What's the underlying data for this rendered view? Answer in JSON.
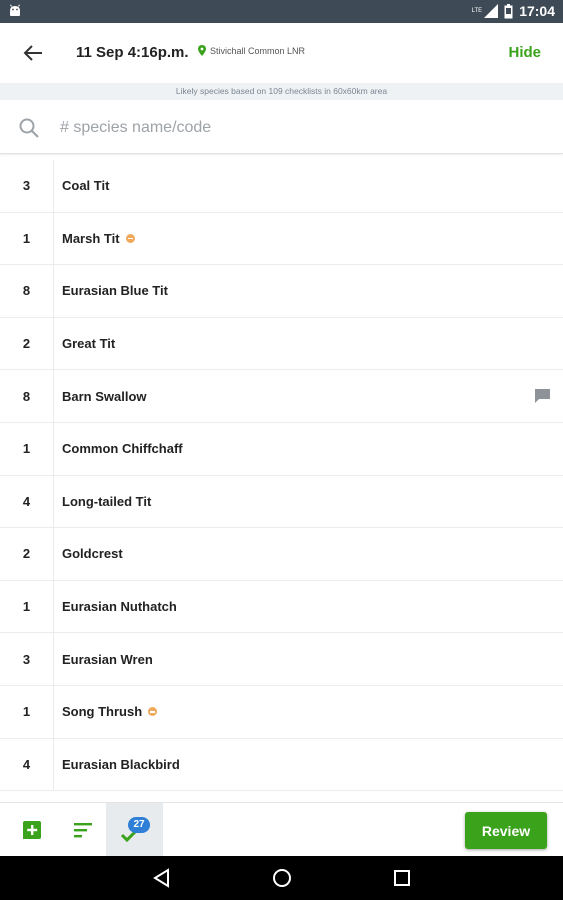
{
  "status_bar": {
    "time": "17:04",
    "network": "LTE"
  },
  "header": {
    "title": "11 Sep 4:16p.m.",
    "location": "Stivichall Common LNR",
    "hide_label": "Hide"
  },
  "banner": {
    "text": "Likely species based on 109 checklists in 60x60km area"
  },
  "search": {
    "placeholder": "# species name/code",
    "value": ""
  },
  "species": [
    {
      "count": "3",
      "name": "Coal Tit",
      "rare": false,
      "comment": false
    },
    {
      "count": "1",
      "name": "Marsh Tit",
      "rare": true,
      "comment": false
    },
    {
      "count": "8",
      "name": "Eurasian Blue Tit",
      "rare": false,
      "comment": false
    },
    {
      "count": "2",
      "name": "Great Tit",
      "rare": false,
      "comment": false
    },
    {
      "count": "8",
      "name": "Barn Swallow",
      "rare": false,
      "comment": true
    },
    {
      "count": "1",
      "name": "Common Chiffchaff",
      "rare": false,
      "comment": false
    },
    {
      "count": "4",
      "name": "Long-tailed Tit",
      "rare": false,
      "comment": false
    },
    {
      "count": "2",
      "name": "Goldcrest",
      "rare": false,
      "comment": false
    },
    {
      "count": "1",
      "name": "Eurasian Nuthatch",
      "rare": false,
      "comment": false
    },
    {
      "count": "3",
      "name": "Eurasian Wren",
      "rare": false,
      "comment": false
    },
    {
      "count": "1",
      "name": "Song Thrush",
      "rare": true,
      "comment": false
    },
    {
      "count": "4",
      "name": "Eurasian Blackbird",
      "rare": false,
      "comment": false
    }
  ],
  "toolbar": {
    "add_icon": "add-box-icon",
    "sort_icon": "sort-icon",
    "checked_icon": "check-icon",
    "checked_count": "27",
    "review_label": "Review"
  },
  "colors": {
    "accent": "#3aa31b",
    "status_bar": "#3e4a55",
    "badge": "#2f7fd6",
    "rare": "#f0a85a"
  }
}
